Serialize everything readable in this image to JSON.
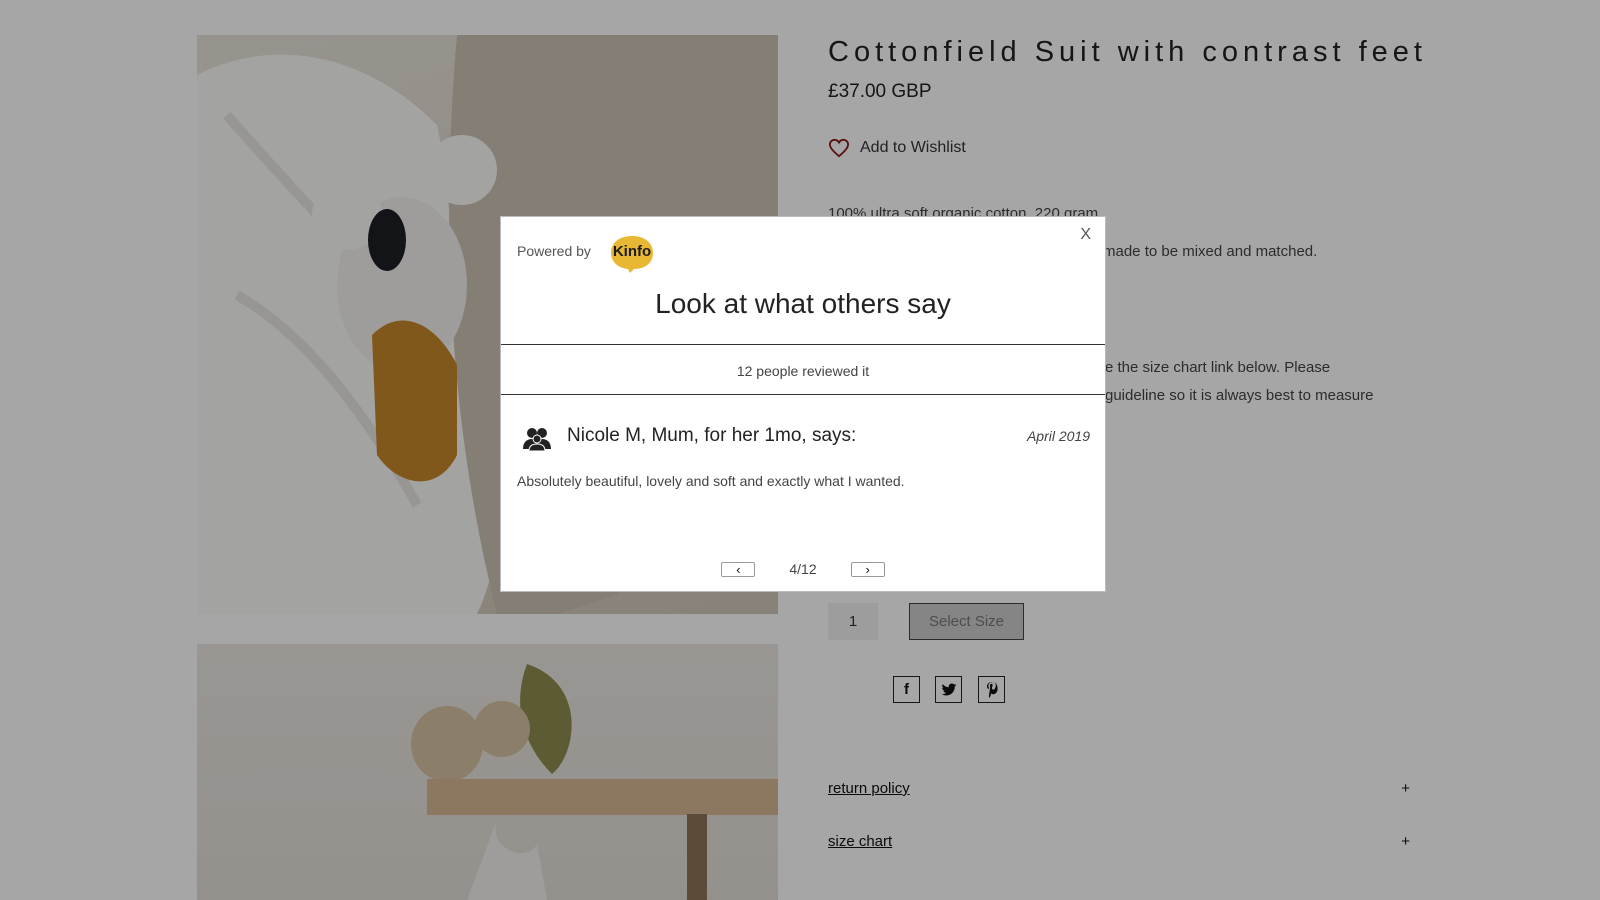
{
  "product": {
    "title": "Cottonfield Suit with contrast feet",
    "price": "£37.00 GBP",
    "wishlist_label": "Add to Wishlist",
    "description_line1": "100% ultra soft organic cotton, 220 gram.",
    "description_line2_visible": "made to be mixed and matched.",
    "size_note_line1_visible": "e the size chart  link below. Please",
    "size_note_line2_visible": " guideline so it is always best to measure",
    "quantity": "1",
    "select_size_label": "Select Size"
  },
  "social": {
    "facebook": "f",
    "twitter_icon": "twitter-icon",
    "pinterest_icon": "pinterest-icon"
  },
  "accordions": [
    {
      "label": "return policy",
      "toggle": "+"
    },
    {
      "label": "size chart",
      "toggle": "+"
    }
  ],
  "modal": {
    "powered_by": "Powered by",
    "logo_text": "Kinfo",
    "close": "X",
    "title": "Look at what others say",
    "review_count": "12 people reviewed it",
    "reviewer": "Nicole M, Mum, for her 1mo, says:",
    "date": "April 2019",
    "review_text": "Absolutely beautiful, lovely and soft and exactly what I wanted.",
    "prev": "‹",
    "next": "›",
    "page": "4/12"
  },
  "colors": {
    "overlay": "#00000059",
    "logo_yellow": "#e8b733",
    "heart": "#8b1a1a"
  }
}
